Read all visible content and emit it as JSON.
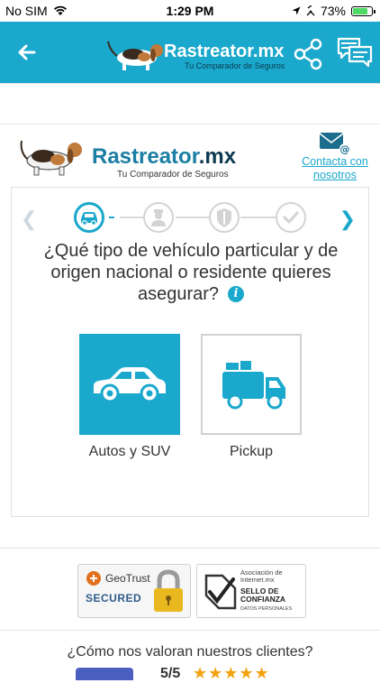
{
  "status_bar": {
    "carrier": "No SIM",
    "time": "1:29 PM",
    "battery": "73%",
    "battery_level": 0.73
  },
  "app_header": {
    "brand": "Rastreator.mx",
    "tagline": "Tu Comparador de Seguros",
    "back_icon": "back-arrow-icon",
    "share_icon": "share-icon",
    "chat_icon": "chat-icon"
  },
  "site_header": {
    "brand_main": "Rastreator",
    "brand_suffix": ".mx",
    "tagline": "Tu Comparador de Seguros",
    "contact_label": "Contacta con nosotros",
    "contact_icon": "mail-icon"
  },
  "stepper": {
    "steps": [
      {
        "icon": "car-icon",
        "active": true
      },
      {
        "icon": "driver-icon",
        "active": false
      },
      {
        "icon": "shield-icon",
        "active": false
      },
      {
        "icon": "check-icon",
        "active": false
      }
    ],
    "prev_icon": "chevron-left-icon",
    "next_icon": "chevron-right-icon"
  },
  "question": {
    "text": "¿Qué tipo de vehículo particular y de origen nacional o residente quieres asegurar?",
    "info_icon_glyph": "i"
  },
  "options": [
    {
      "label": "Autos y SUV",
      "icon": "car-icon",
      "selected": true
    },
    {
      "label": "Pickup",
      "icon": "truck-icon",
      "selected": false
    }
  ],
  "badges": {
    "geotrust_title": "GeoTrust",
    "geotrust_secured": "SECURED",
    "amipci_line1": "Asociación de",
    "amipci_line2": "Internet.mx",
    "amipci_seal1": "SELLO DE",
    "amipci_seal2": "CONFIANZA",
    "amipci_small": "DATOS PERSONALES"
  },
  "rating": {
    "question": "¿Cómo nos valoran nuestros clientes?",
    "score": "5/5",
    "stars": "★★★★★"
  },
  "colors": {
    "accent": "#1aa8cc",
    "dark_brand": "#0f3b52",
    "star": "#f2a20c"
  }
}
